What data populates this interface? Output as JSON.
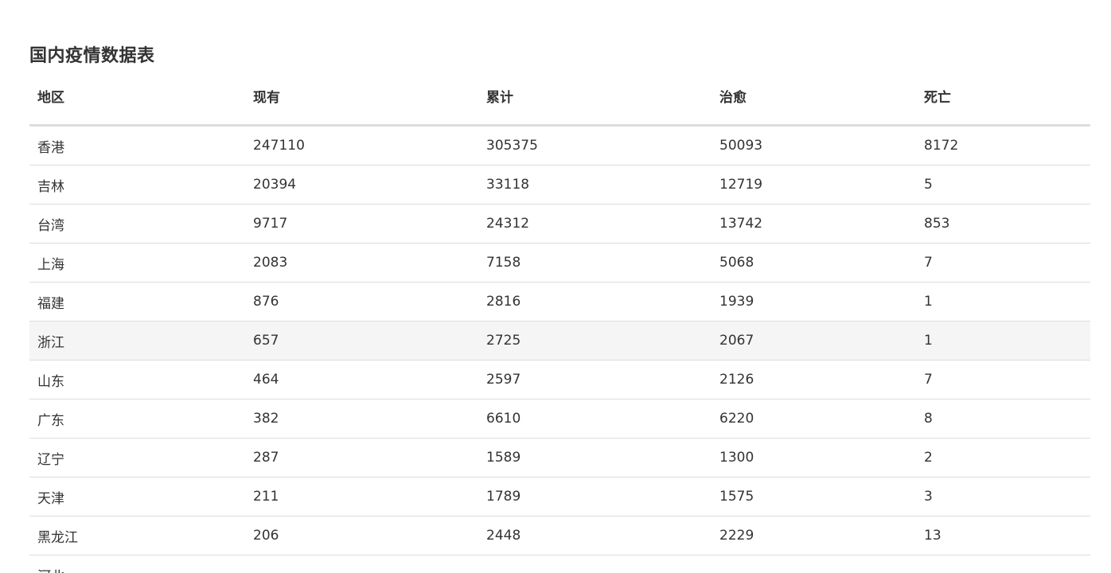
{
  "title": "国内疫情数据表",
  "columns": [
    "地区",
    "现有",
    "累计",
    "治愈",
    "死亡"
  ],
  "rows": [
    {
      "region": "香港",
      "current": "247110",
      "total": "305375",
      "cured": "50093",
      "dead": "8172"
    },
    {
      "region": "吉林",
      "current": "20394",
      "total": "33118",
      "cured": "12719",
      "dead": "5"
    },
    {
      "region": "台湾",
      "current": "9717",
      "total": "24312",
      "cured": "13742",
      "dead": "853"
    },
    {
      "region": "上海",
      "current": "2083",
      "total": "7158",
      "cured": "5068",
      "dead": "7"
    },
    {
      "region": "福建",
      "current": "876",
      "total": "2816",
      "cured": "1939",
      "dead": "1"
    },
    {
      "region": "浙江",
      "current": "657",
      "total": "2725",
      "cured": "2067",
      "dead": "1"
    },
    {
      "region": "山东",
      "current": "464",
      "total": "2597",
      "cured": "2126",
      "dead": "7"
    },
    {
      "region": "广东",
      "current": "382",
      "total": "6610",
      "cured": "6220",
      "dead": "8"
    },
    {
      "region": "辽宁",
      "current": "287",
      "total": "1589",
      "cured": "1300",
      "dead": "2"
    },
    {
      "region": "天津",
      "current": "211",
      "total": "1789",
      "cured": "1575",
      "dead": "3"
    },
    {
      "region": "黑龙江",
      "current": "206",
      "total": "2448",
      "cured": "2229",
      "dead": "13"
    },
    {
      "region": "河北",
      "current": "",
      "total": "",
      "cured": "",
      "dead": ""
    }
  ],
  "hovered_row_region": "浙江",
  "colors": {
    "text": "#333333",
    "border": "#dddddd",
    "hover_row": "#f5f5f5"
  }
}
